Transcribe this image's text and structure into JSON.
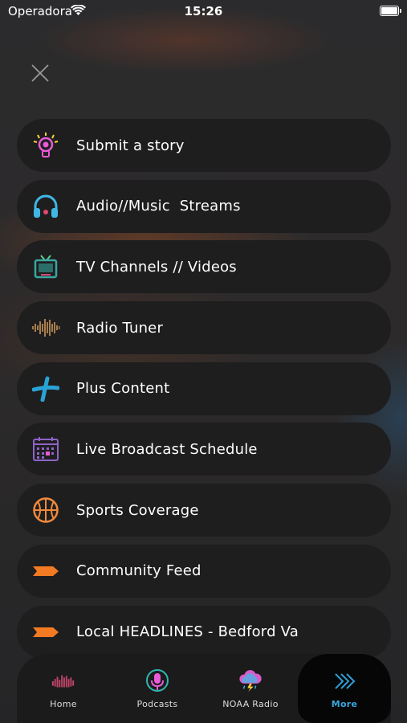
{
  "status_bar": {
    "carrier": "Operadora",
    "time": "15:26"
  },
  "close_button": {
    "icon": "close-icon"
  },
  "menu": {
    "items": [
      {
        "label": "Submit a story",
        "icon": "lightbulb-icon",
        "color": "#e85bd6"
      },
      {
        "label": "Audio//Music  Streams",
        "icon": "headphones-icon",
        "color": "#3fb8e6"
      },
      {
        "label": "TV Channels // Videos",
        "icon": "tv-icon",
        "color": "#3aa7a0"
      },
      {
        "label": "Radio Tuner",
        "icon": "soundwave-icon",
        "color": "#a87d4e"
      },
      {
        "label": "Plus Content",
        "icon": "plus-icon",
        "color": "#29a3d6"
      },
      {
        "label": "Live Broadcast Schedule",
        "icon": "calendar-icon",
        "color": "#8e64c8"
      },
      {
        "label": "Sports Coverage",
        "icon": "basketball-icon",
        "color": "#f08a3c"
      },
      {
        "label": "Community Feed",
        "icon": "tag-arrow-icon",
        "color": "#f27a22"
      },
      {
        "label": "Local HEADLINES - Bedford Va",
        "icon": "tag-arrow-icon",
        "color": "#f27a22"
      }
    ]
  },
  "tabbar": {
    "tabs": [
      {
        "label": "Home",
        "icon": "home-soundwave-icon"
      },
      {
        "label": "Podcasts",
        "icon": "podcast-mic-icon"
      },
      {
        "label": "NOAA Radio",
        "icon": "storm-cloud-icon"
      },
      {
        "label": "More",
        "icon": "double-chevron-icon",
        "active": true
      }
    ]
  }
}
